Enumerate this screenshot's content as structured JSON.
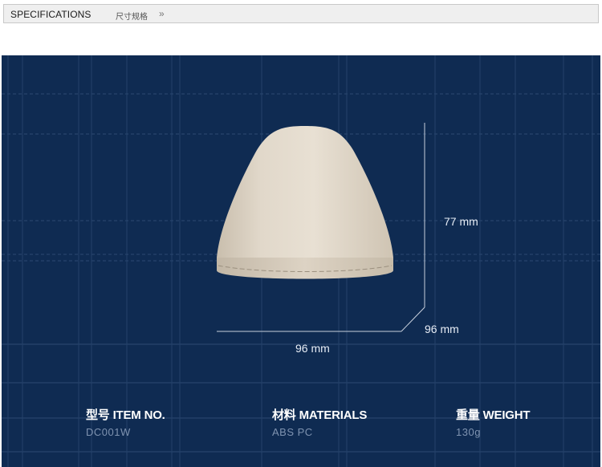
{
  "header": {
    "title": "SPECIFICATIONS",
    "subtitle": "尺寸规格",
    "arrow": "»"
  },
  "dimensions": {
    "height": "77 mm",
    "depth": "96 mm",
    "width": "96 mm"
  },
  "specs": [
    {
      "title": "型号 ITEM NO.",
      "value": "DC001W"
    },
    {
      "title": "材料 MATERIALS",
      "value": "ABS  PC"
    },
    {
      "title": "重量 WEIGHT",
      "value": "130g"
    }
  ],
  "colors": {
    "panel_background": "#0f2b52",
    "product": "#ddd3c4"
  }
}
